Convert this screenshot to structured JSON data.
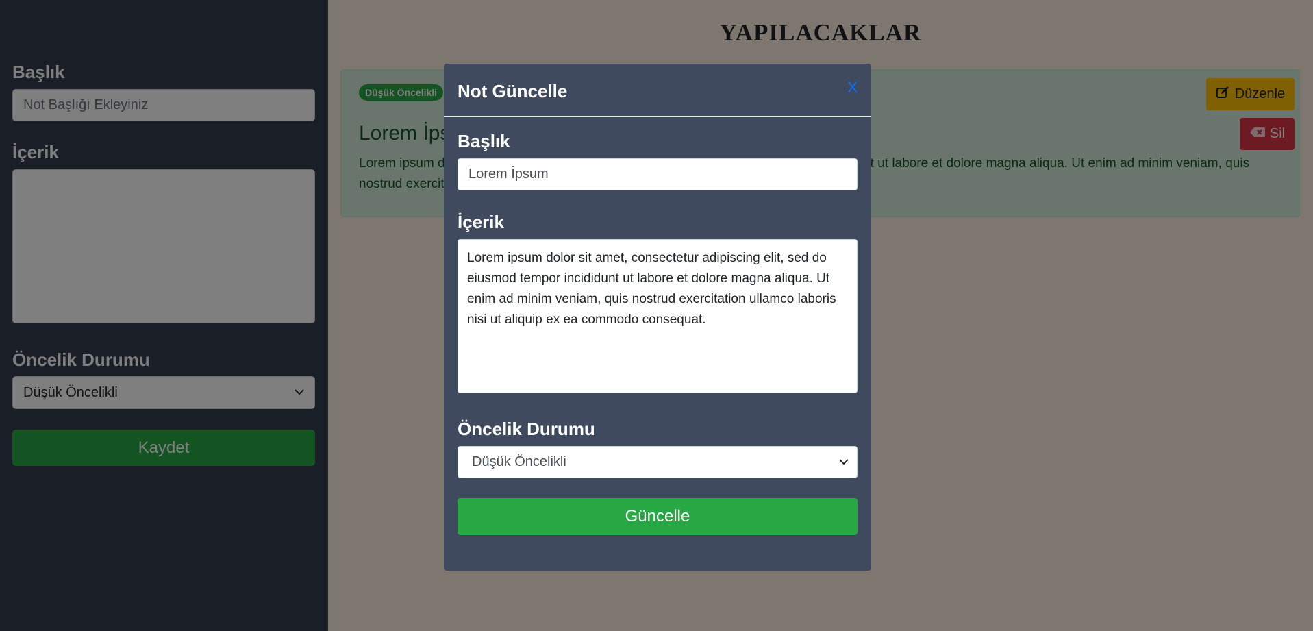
{
  "sidebar": {
    "title_label": "Başlık",
    "title_placeholder": "Not Başlığı Ekleyiniz",
    "content_label": "İçerik",
    "priority_label": "Öncelik Durumu",
    "priority_value": "Düşük Öncelikli",
    "save_label": "Kaydet"
  },
  "main": {
    "page_title": "YAPILACAKLAR",
    "note": {
      "badge": "Düşük Öncelikli",
      "title": "Lorem İpsum",
      "text": "Lorem ipsum dolor sit amet, consectetur adipiscing elit, sed do eiusmod tempor incididunt ut labore et dolore magna aliqua. Ut enim ad minim veniam, quis nostrud exercitation ullamco laboris nisi ut aliquip ex ea commodo consequat.",
      "edit_label": "Düzenle",
      "delete_label": "Sil"
    }
  },
  "modal": {
    "title": "Not Güncelle",
    "close_label": "X",
    "title_label": "Başlık",
    "title_value": "Lorem İpsum",
    "content_label": "İçerik",
    "content_value": "Lorem ipsum dolor sit amet, consectetur adipiscing elit, sed do eiusmod tempor incididunt ut labore et dolore magna aliqua. Ut enim ad minim veniam, quis nostrud exercitation ullamco laboris nisi ut aliquip ex ea commodo consequat.",
    "priority_label": "Öncelik Durumu",
    "priority_value": "Düşük Öncelikli",
    "update_label": "Güncelle"
  },
  "colors": {
    "sidebar_bg": "#343d4e",
    "modal_bg": "#3f4a5e",
    "success": "#28a745",
    "warning": "#ffc107",
    "danger": "#dc3545",
    "link": "#0d6efd"
  },
  "icons": {
    "edit": "edit-icon",
    "delete": "backspace-icon",
    "select": "chevron-down-icon"
  }
}
